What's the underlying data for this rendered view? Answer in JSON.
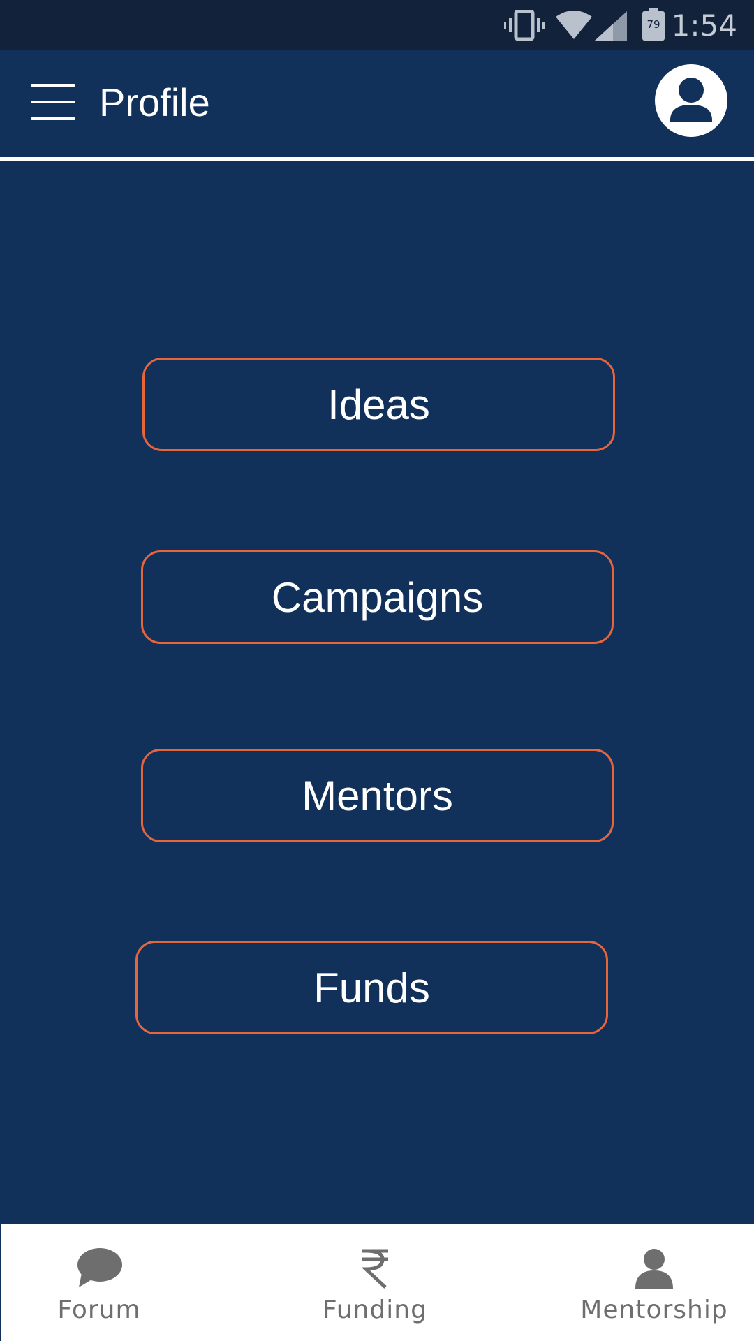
{
  "status_bar": {
    "time": "1:54",
    "battery_level": "79",
    "icons": [
      "vibrate-icon",
      "wifi-icon",
      "cell-signal-icon",
      "battery-icon"
    ]
  },
  "app_bar": {
    "title": "Profile",
    "menu_icon": "hamburger-menu-icon",
    "avatar_icon": "user-avatar-icon"
  },
  "main": {
    "buttons": [
      {
        "label": "Ideas"
      },
      {
        "label": "Campaigns"
      },
      {
        "label": "Mentors"
      },
      {
        "label": "Funds"
      }
    ]
  },
  "bottom_nav": {
    "items": [
      {
        "label": "Forum",
        "icon": "chat-bubble-icon"
      },
      {
        "label": "Funding",
        "icon": "rupee-icon"
      },
      {
        "label": "Mentorship",
        "icon": "person-icon"
      }
    ]
  },
  "colors": {
    "background": "#11305a",
    "status_bar": "#13223b",
    "accent_border": "#e8653c",
    "nav_icon": "#6e6e6e"
  }
}
